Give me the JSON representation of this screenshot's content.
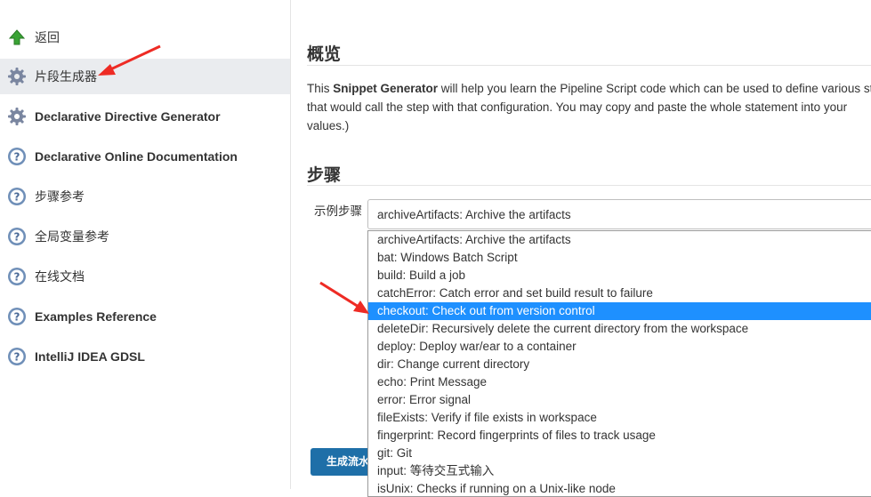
{
  "sidebar": {
    "items": [
      {
        "label": "返回",
        "icon": "up-arrow-icon"
      },
      {
        "label": "片段生成器",
        "icon": "gear-icon"
      },
      {
        "label": "Declarative Directive Generator",
        "icon": "gear-icon"
      },
      {
        "label": "Declarative Online Documentation",
        "icon": "help-icon"
      },
      {
        "label": "步骤参考",
        "icon": "help-icon"
      },
      {
        "label": "全局变量参考",
        "icon": "help-icon"
      },
      {
        "label": "在线文档",
        "icon": "help-icon"
      },
      {
        "label": "Examples Reference",
        "icon": "help-icon"
      },
      {
        "label": "IntelliJ IDEA GDSL",
        "icon": "help-icon"
      }
    ]
  },
  "main": {
    "overview_title": "概览",
    "desc_prefix": "This ",
    "desc_bold": "Snippet Generator",
    "desc_line1_rest": " will help you learn the Pipeline Script code which can be used to define various steps",
    "desc_line2": "that would call the step with that configuration. You may copy and paste the whole statement into your",
    "desc_line3": "values.)",
    "steps_title": "步骤",
    "sample_step_label": "示例步骤",
    "selected_value": "archiveArtifacts: Archive the artifacts",
    "generate_button": "生成流水线脚本",
    "options": [
      "archiveArtifacts: Archive the artifacts",
      "bat: Windows Batch Script",
      "build: Build a job",
      "catchError: Catch error and set build result to failure",
      "checkout: Check out from version control",
      "deleteDir: Recursively delete the current directory from the workspace",
      "deploy: Deploy war/ear to a container",
      "dir: Change current directory",
      "echo: Print Message",
      "error: Error signal",
      "fileExists: Verify if file exists in workspace",
      "fingerprint: Record fingerprints of files to track usage",
      "git: Git",
      "input: 等待交互式输入",
      "isUnix: Checks if running on a Unix-like node"
    ],
    "highlighted_option_index": 4
  },
  "colors": {
    "highlight": "#1e90ff",
    "annotation_arrow": "#ee2b24",
    "button": "#1e6fa8"
  }
}
